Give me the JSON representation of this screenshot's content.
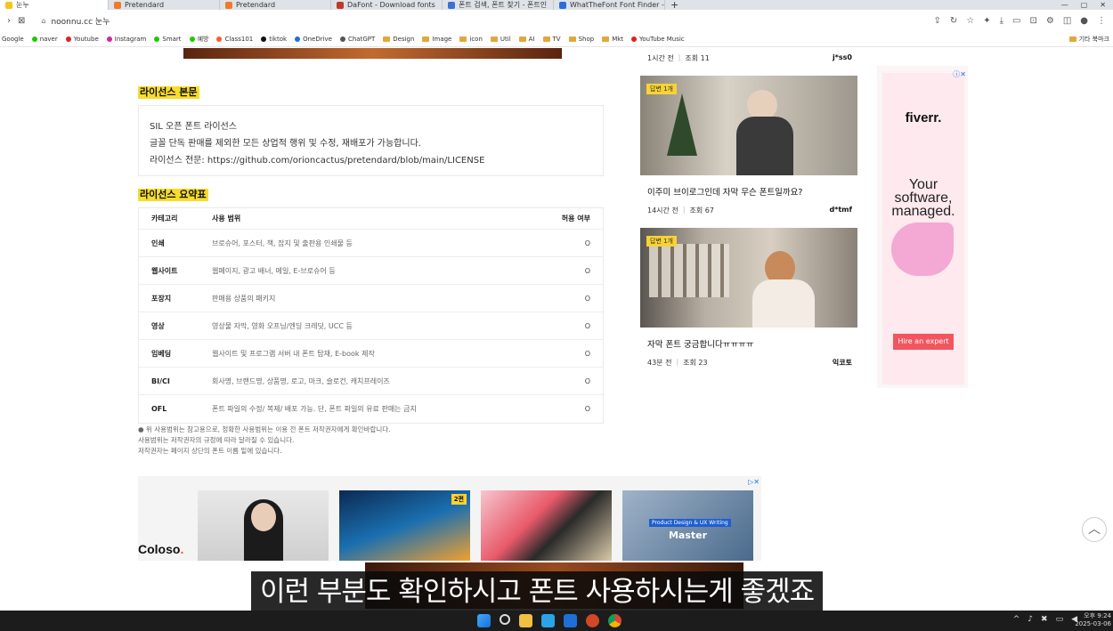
{
  "tabs": [
    {
      "label": "눈누",
      "color": "#f5c518",
      "active": true
    },
    {
      "label": "Pretendard",
      "color": "#f07a2a"
    },
    {
      "label": "Pretendard",
      "color": "#f07a2a"
    },
    {
      "label": "DaFont - Download fonts",
      "color": "#c0392b"
    },
    {
      "label": "폰트 검색, 폰트 찾기 - 폰트인",
      "color": "#3b6fd6"
    },
    {
      "label": "WhatTheFont Font Finder - Id",
      "color": "#2d6cdf"
    }
  ],
  "address": {
    "url": "noonnu.cc 눈누"
  },
  "bookmarks": [
    {
      "label": "Google",
      "type": "none"
    },
    {
      "label": "naver",
      "type": "dot",
      "color": "#1ec800"
    },
    {
      "label": "Youtube",
      "type": "dot",
      "color": "#e02020"
    },
    {
      "label": "Instagram",
      "type": "dot",
      "color": "#d6249f"
    },
    {
      "label": "Smart",
      "type": "dot",
      "color": "#1ec800"
    },
    {
      "label": "예방",
      "type": "dot",
      "color": "#1ec800"
    },
    {
      "label": "Class101",
      "type": "dot",
      "color": "#ff5a2b"
    },
    {
      "label": "tiktok",
      "type": "dot",
      "color": "#111111"
    },
    {
      "label": "OneDrive",
      "type": "dot",
      "color": "#1e6fd9"
    },
    {
      "label": "ChatGPT",
      "type": "dot",
      "color": "#555555"
    },
    {
      "label": "Design",
      "type": "folder"
    },
    {
      "label": "Image",
      "type": "folder"
    },
    {
      "label": "icon",
      "type": "folder"
    },
    {
      "label": "Util",
      "type": "folder"
    },
    {
      "label": "AI",
      "type": "folder"
    },
    {
      "label": "TV",
      "type": "folder"
    },
    {
      "label": "Shop",
      "type": "folder"
    },
    {
      "label": "Mkt",
      "type": "folder"
    },
    {
      "label": "YouTube Music",
      "type": "dot",
      "color": "#e02020"
    }
  ],
  "bookmarks_other": "기타 북마크",
  "license_body": {
    "title": "라이선스 본문",
    "lines": [
      "SIL 오픈 폰트 라이선스",
      "글꼴 단독 판매를 제외한 모든 상업적 행위 및 수정, 재배포가 가능합니다.",
      "라이선스 전문: https://github.com/orioncactus/pretendard/blob/main/LICENSE"
    ]
  },
  "license_table": {
    "title": "라이선스 요약표",
    "headers": {
      "category": "카테고리",
      "scope": "사용 범위",
      "allowed": "허용 여부"
    },
    "rows": [
      {
        "category": "인쇄",
        "scope": "브로슈어, 포스터, 책, 잡지 및 출판용 인쇄물 등",
        "allowed": "O"
      },
      {
        "category": "웹사이트",
        "scope": "웹페이지, 광고 배너, 메일, E-브로슈어 등",
        "allowed": "O"
      },
      {
        "category": "포장지",
        "scope": "판매용 상품의 패키지",
        "allowed": "O"
      },
      {
        "category": "영상",
        "scope": "영상물 자막, 영화 오프닝/엔딩 크레딧, UCC 등",
        "allowed": "O"
      },
      {
        "category": "임베딩",
        "scope": "웹사이트 및 프로그램 서버 내 폰트 탑재, E-book 제작",
        "allowed": "O"
      },
      {
        "category": "BI/CI",
        "scope": "회사명, 브랜드명, 상품명, 로고, 마크, 슬로건, 캐치프레이즈",
        "allowed": "O"
      },
      {
        "category": "OFL",
        "scope": "폰트 파일의 수정/ 복제/ 배포 가능. 단, 폰트 파일의 유료 판매는 금지",
        "allowed": "O"
      }
    ],
    "notes": [
      "● 위 사용범위는 참고용으로, 정확한 사용범위는 이용 전 폰트 저작권자에게 확인바랍니다.",
      "사용범위는 저작권자의 규정에 따라 달라질 수 있습니다.",
      "저작권자는 페이지 상단의 폰트 이름 밑에 있습니다."
    ]
  },
  "ad_banner": {
    "logo_main": "Coloso",
    "logo_dot": ".",
    "badge": "2편",
    "master_label": "Master",
    "product_label": "Product Design & UX Writing"
  },
  "cards": [
    {
      "time": "1시간 전",
      "views": "조회 11",
      "author": "j*ss0"
    },
    {
      "badge": "답변 1개",
      "title": "이주미 브이로그인데 자막 무슨 폰트일까요?",
      "time": "14시간 전",
      "views": "조회 67",
      "author": "d*tmf"
    },
    {
      "badge": "답변 1개",
      "title": "자막 폰트 궁금합니다ㅠㅠㅠㅠ",
      "time": "43분 전",
      "views": "조회 23",
      "author": "익코토"
    }
  ],
  "fiverr": {
    "logo": "fiverr.",
    "tagline": [
      "Your",
      "software,",
      "managed."
    ],
    "button": "Hire an expert"
  },
  "subtitle": "이런 부분도 확인하시고 폰트 사용하시는게 좋겠죠",
  "clock": {
    "time": "오후 9:24",
    "date": "2025-03-06"
  }
}
